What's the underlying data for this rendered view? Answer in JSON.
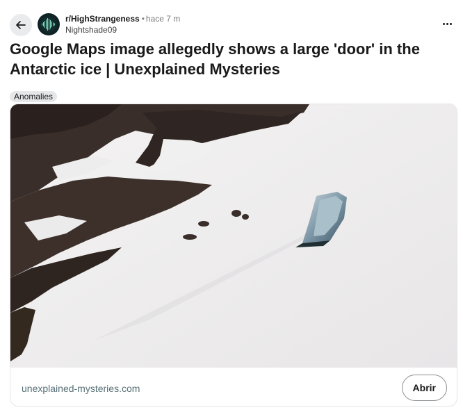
{
  "header": {
    "back_icon": "arrow-left-icon",
    "subreddit": "r/HighStrangeness",
    "separator": "•",
    "time": "hace 7 m",
    "username": "Nightshade09",
    "more_icon": "more-horizontal-icon"
  },
  "post": {
    "title": "Google Maps image allegedly shows a large 'door' in the Antarctic ice | Unexplained Mysteries",
    "flair": "Anomalies"
  },
  "link_card": {
    "domain": "unexplained-mysteries.com",
    "open_label": "Abrir"
  },
  "colors": {
    "text": "#1a1a1b",
    "muted": "#7c7c7c",
    "flair_bg": "#e5e7e9",
    "button_border": "#8a8e91",
    "domain": "#576f76"
  }
}
